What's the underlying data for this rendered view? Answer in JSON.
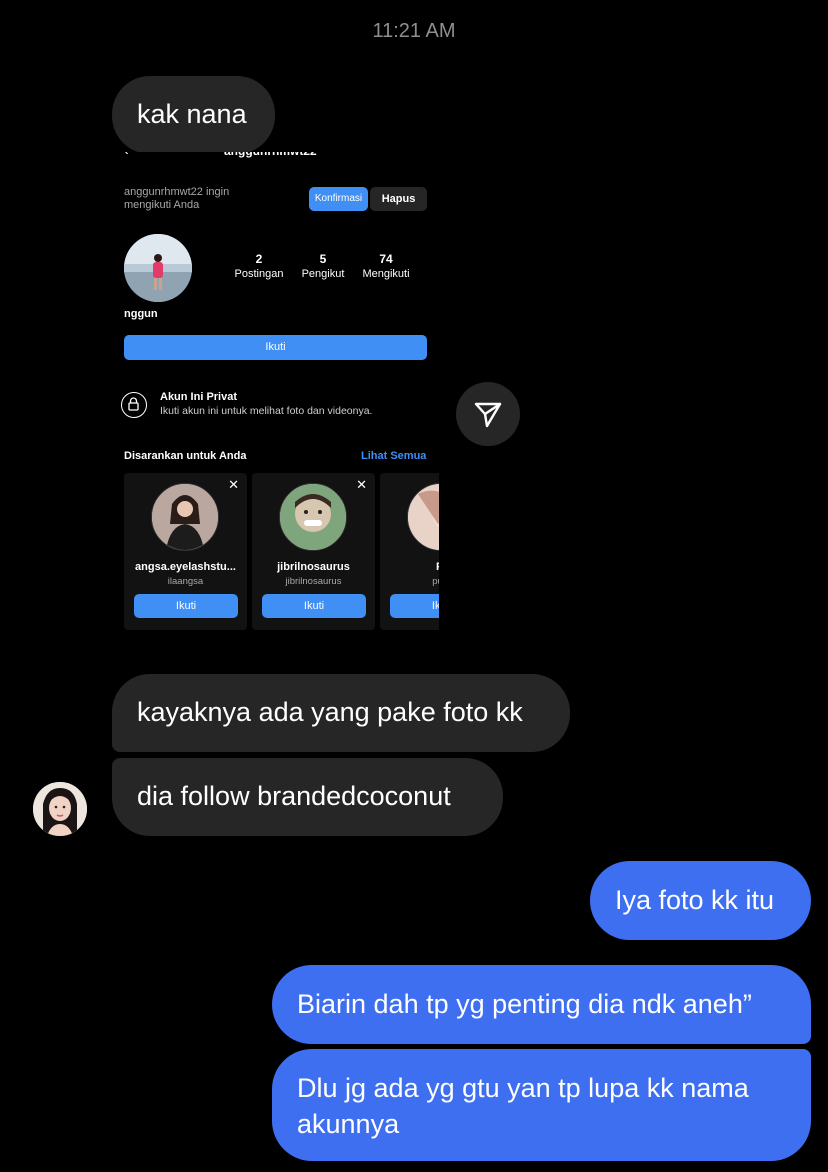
{
  "timestamp": "11:21 AM",
  "messages": {
    "m1": "kak nana",
    "m2": "kayaknya ada yang pake foto kk",
    "m3": "dia follow brandedcoconut",
    "m4": "Iya foto kk itu",
    "m5": "Biarin dah tp yg penting dia ndk aneh”",
    "m6": "Dlu jg ada yg gtu yan tp lupa kk nama akunnya"
  },
  "shared_screenshot": {
    "header_username": "anggunrhmwt22",
    "request_text": "anggunrhmwt22 ingin mengikuti Anda",
    "confirm_label": "Konfirmasi",
    "delete_label": "Hapus",
    "stats": [
      {
        "num": "2",
        "label": "Postingan"
      },
      {
        "num": "5",
        "label": "Pengikut"
      },
      {
        "num": "74",
        "label": "Mengikuti"
      }
    ],
    "display_name": "nggun",
    "follow_label": "Ikuti",
    "private_title": "Akun Ini Privat",
    "private_subtitle": "Ikuti akun ini untuk melihat foto dan videonya.",
    "suggested_title": "Disarankan untuk Anda",
    "see_all_label": "Lihat Semua",
    "cards": [
      {
        "name": "angsa.eyelashstu...",
        "handle": "ilaangsa",
        "button": "Ikuti"
      },
      {
        "name": "jibrilnosaurus",
        "handle": "jibrilnosaurus",
        "button": "Ikuti"
      },
      {
        "name": "Pt",
        "handle": "puttt",
        "button": "Ikuti"
      }
    ]
  },
  "icons": {
    "share": "paper-plane-icon",
    "lock": "lock-icon",
    "close": "close-icon"
  },
  "colors": {
    "background": "#000000",
    "received_bubble": "#262626",
    "sent_bubble": "#3e6ff0",
    "ig_blue": "#3f8ff4"
  }
}
